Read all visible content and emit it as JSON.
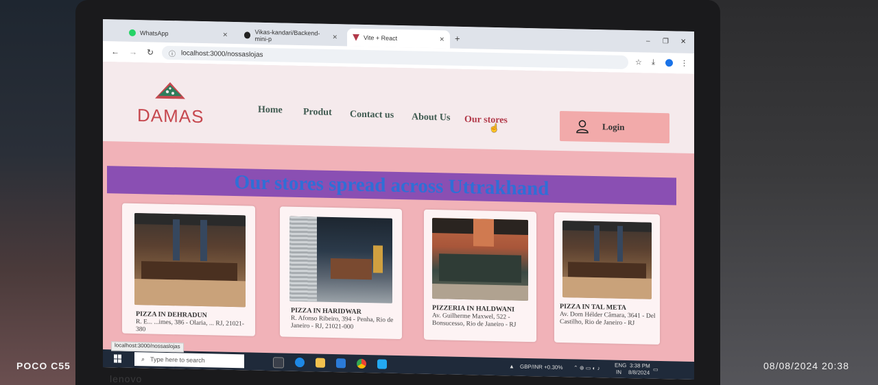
{
  "browser": {
    "tabs": [
      {
        "label": "WhatsApp",
        "icon": "whatsapp-icon",
        "color": "#25d366"
      },
      {
        "label": "Vikas-kandari/Backend-mini-p",
        "icon": "github-icon",
        "color": "#222222"
      },
      {
        "label": "Vite + React",
        "icon": "vite-icon",
        "color": "#b23a4a",
        "active": true
      }
    ],
    "new_tab": "+",
    "address": "localhost:3000/nossaslojas"
  },
  "site": {
    "logo_text": "DAMAS",
    "nav": [
      "Home",
      "Produt",
      "Contact us",
      "About Us",
      "Our stores"
    ],
    "active_nav": "Our stores",
    "login_label": "Login",
    "banner": "Our stores spread across Uttrakhand",
    "stores": [
      {
        "title": "PIZZA IN DEHRADUN",
        "address": "R. E... ...imes, 386 - Olaria, ... RJ, 21021-380"
      },
      {
        "title": "PIZZA IN HARIDWAR",
        "address": "R. Afonso Ribeiro, 394 - Penha, Rio de Janeiro - RJ, 21021-000"
      },
      {
        "title": "PIZZERIA IN HALDWANI",
        "address": "Av. Guilherme Maxwel, 522 - Bonsucesso, Rio de Janeiro - RJ"
      },
      {
        "title": "PIZZA IN TAL META",
        "address": "Av. Dom Hélder Câmara, 3641 - Del Castilho, Rio de Janeiro - RJ"
      }
    ]
  },
  "status_url": "localhost:3000/nossaslojas",
  "taskbar": {
    "search_placeholder": "Type here to search",
    "ticker": "GBP/INR +0.30%",
    "lang": "ENG",
    "region": "IN",
    "time": "3:38 PM",
    "date": "8/8/2024"
  },
  "photo_watermark": {
    "device": "POCO C55",
    "timestamp": "08/08/2024  20:38"
  },
  "colors": {
    "accent": "#c6484f",
    "banner_bg": "#8a4fb3",
    "banner_text": "#2f6fd6",
    "hero_bg": "#f1b2b8",
    "login_bg": "#f2aaaa"
  }
}
